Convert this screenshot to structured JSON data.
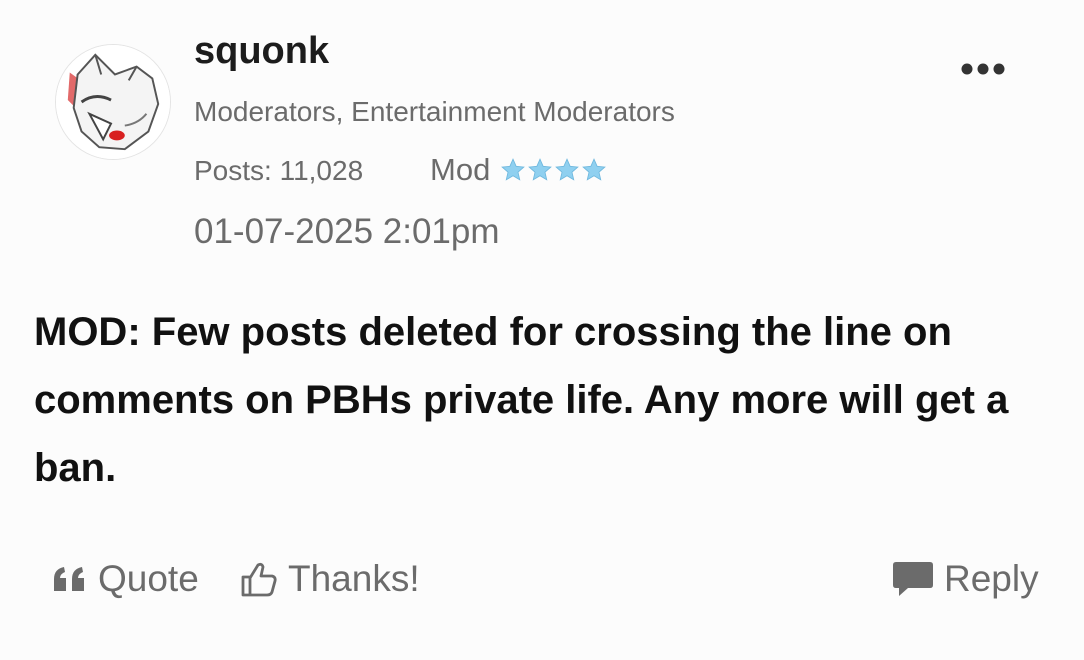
{
  "post": {
    "author": {
      "username": "squonk",
      "roles": "Moderators, Entertainment Moderators",
      "posts_label": "Posts: 11,028",
      "rank": "Mod",
      "rank_stars": 4
    },
    "timestamp": "01-07-2025 2:01pm",
    "body": "MOD: Few posts deleted for crossing the line on comments on PBHs private life. Any more will get a ban.",
    "actions": {
      "quote": "Quote",
      "thanks": "Thanks!",
      "reply": "Reply"
    }
  },
  "colors": {
    "background": "#fcfcfc",
    "text_primary": "#111111",
    "text_secondary": "#6b6b6b",
    "star": "#8fd0f0"
  },
  "icons": [
    "more-options-icon",
    "quote-icon",
    "thumbs-up-icon",
    "speech-bubble-icon",
    "star-icon"
  ]
}
